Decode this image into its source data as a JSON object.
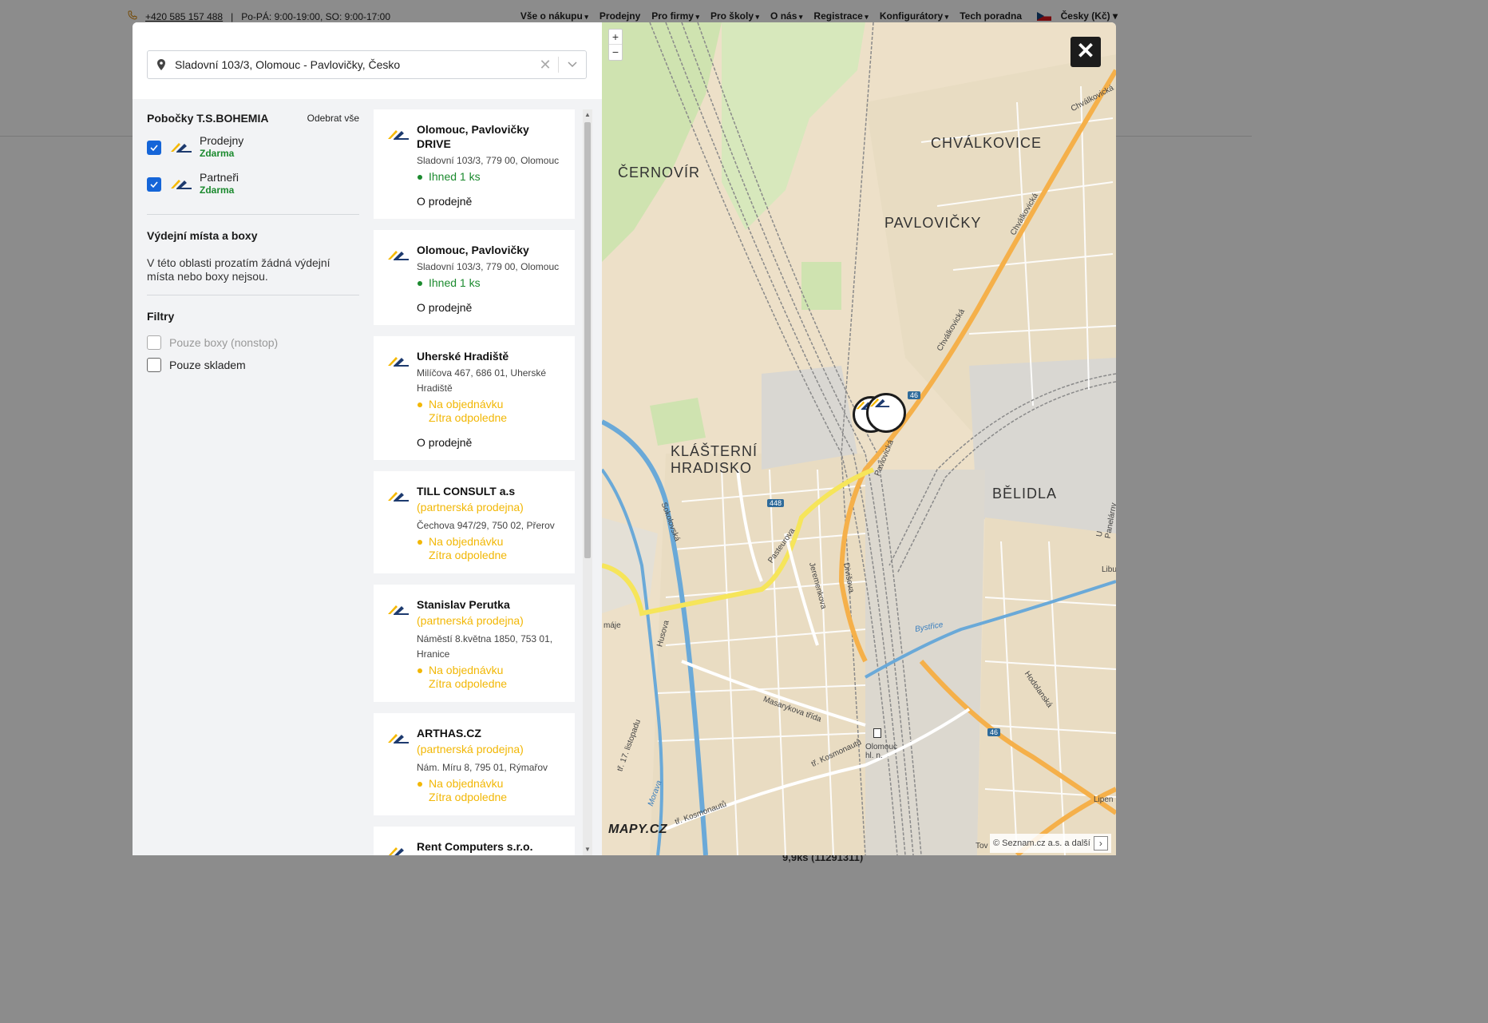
{
  "background": {
    "phone": "+420 585 157 488",
    "hours": "Po-PÁ: 9:00-19:00, SO: 9:00-17:00",
    "nav": [
      "Vše o nákupu",
      "Prodejny",
      "Pro firmy",
      "Pro školy",
      "O nás",
      "Registrace",
      "Konfigurátory",
      "Tech poradna"
    ],
    "language": "Česky (Kč)",
    "bottom_text": "9,9ks (11291311)"
  },
  "search": {
    "value": "Sladovní 103/3, Olomouc - Pavlovičky, Česko"
  },
  "filters": {
    "branches_title": "Pobočky T.S.BOHEMIA",
    "remove_all": "Odebrat vše",
    "branch_types": [
      {
        "label": "Prodejny",
        "price": "Zdarma",
        "checked": true
      },
      {
        "label": "Partneři",
        "price": "Zdarma",
        "checked": true
      }
    ],
    "pickup_title": "Výdejní místa a boxy",
    "pickup_note": "V této oblasti prozatím žádná výdejní místa nebo boxy nejsou.",
    "filter_title": "Filtry",
    "options": [
      {
        "label": "Pouze boxy (nonstop)",
        "disabled": true
      },
      {
        "label": "Pouze skladem",
        "disabled": false
      }
    ]
  },
  "stores": [
    {
      "name": "Olomouc, Pavlovičky DRIVE",
      "partner": "",
      "address": "Sladovní 103/3, 779 00, Olomouc",
      "stock": [
        "Ihned 1 ks"
      ],
      "stock_color": "green",
      "link": "O prodejně"
    },
    {
      "name": "Olomouc, Pavlovičky",
      "partner": "",
      "address": "Sladovní 103/3, 779 00, Olomouc",
      "stock": [
        "Ihned 1 ks"
      ],
      "stock_color": "green",
      "link": "O prodejně"
    },
    {
      "name": "Uherské Hradiště",
      "partner": "",
      "address": "Milíčova 467, 686 01, Uherské Hradiště",
      "stock": [
        "Na objednávku",
        "Zítra odpoledne"
      ],
      "stock_color": "orange",
      "link": "O prodejně"
    },
    {
      "name": "TILL CONSULT a.s",
      "partner": "(partnerská prodejna)",
      "address": "Čechova 947/29, 750 02, Přerov",
      "stock": [
        "Na objednávku",
        "Zítra odpoledne"
      ],
      "stock_color": "orange",
      "link": ""
    },
    {
      "name": "Stanislav Perutka",
      "partner": "(partnerská prodejna)",
      "address": "Náměstí 8.května 1850, 753 01, Hranice",
      "stock": [
        "Na objednávku",
        "Zítra odpoledne"
      ],
      "stock_color": "orange",
      "link": ""
    },
    {
      "name": "ARTHAS.CZ",
      "partner": "(partnerská prodejna)",
      "address": "Nám. Míru 8, 795 01, Rýmařov",
      "stock": [
        "Na objednávku",
        "Zítra odpoledne"
      ],
      "stock_color": "orange",
      "link": ""
    },
    {
      "name": "Rent Computers s.r.o.",
      "partner": "",
      "address": "",
      "stock": [],
      "stock_color": "orange",
      "link": ""
    }
  ],
  "map": {
    "zoom_in": "+",
    "zoom_out": "−",
    "close": "✕",
    "logo": "MAPY.CZ",
    "copyright": "© Seznam.cz a.s. a další",
    "copyright_more": "›",
    "districts": [
      "ČERNOVÍR",
      "CHVÁLKOVICE",
      "PAVLOVIČKY",
      "KLÁŠTERNÍ HRADISKO",
      "BĚLIDLA"
    ],
    "streets": [
      "Chválkovická",
      "Sokolovská",
      "Pavlovická",
      "Pasteurova",
      "Jeremenkova",
      "Divišova",
      "Husova",
      "Masarykova třída",
      "tř. Kosmonautů",
      "Hodolanská",
      "U Panelárny",
      "Bystřice",
      "Olomouc hl. n.",
      "Libu",
      "Lipen",
      "Tov",
      "máje",
      "tř. 17. listopadu",
      "Morava"
    ],
    "road_numbers": [
      "46",
      "448",
      "46"
    ],
    "colors": {
      "land": "#ede0c8",
      "park": "#cfe3b0",
      "water": "#6aa9d8",
      "major_road": "#f5b04a",
      "secondary_road": "#f6e55a",
      "rail": "#888888"
    }
  },
  "colors": {
    "accent_blue": "#1565d8",
    "green": "#1b8a2e",
    "orange": "#f2b705",
    "logo_yellow": "#f5b800",
    "logo_navy": "#1d3a6e"
  }
}
